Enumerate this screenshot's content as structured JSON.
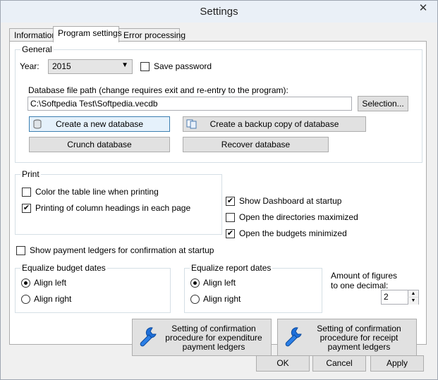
{
  "window": {
    "title": "Settings",
    "close_glyph": "✕"
  },
  "tabs": [
    {
      "label": "Information"
    },
    {
      "label": "Program settings"
    },
    {
      "label": "Error processing"
    }
  ],
  "general": {
    "label": "General",
    "year_label": "Year:",
    "year_value": "2015",
    "save_password_label": "Save password",
    "save_password_checked": false,
    "db_path_label": "Database file path (change requires exit and re-entry to the program):",
    "db_path_value": "C:\\Softpedia Test\\Softpedia.vecdb",
    "selection_button": "Selection...",
    "create_db_button": "Create a new database",
    "backup_button": "Create a backup copy of database",
    "crunch_button": "Crunch database",
    "recover_button": "Recover database"
  },
  "print": {
    "label": "Print",
    "color_line_label": "Color the table line when printing",
    "color_line_checked": false,
    "column_headings_label": "Printing of column headings in each page",
    "column_headings_checked": true
  },
  "options": {
    "show_dashboard_label": "Show Dashboard at startup",
    "show_dashboard_checked": true,
    "dirs_maximized_label": "Open the directories maximized",
    "dirs_maximized_checked": false,
    "budgets_minimized_label": "Open the budgets minimized",
    "budgets_minimized_checked": true,
    "payment_ledgers_label": "Show payment ledgers for confirmation at startup",
    "payment_ledgers_checked": false
  },
  "equalize_budget": {
    "label": "Equalize budget dates",
    "align_left": "Align left",
    "align_right": "Align right",
    "selected": "left"
  },
  "equalize_report": {
    "label": "Equalize report dates",
    "align_left": "Align left",
    "align_right": "Align right",
    "selected": "left"
  },
  "figures": {
    "label_line1": "Amount of figures",
    "label_line2": "to one decimal:",
    "value": "2"
  },
  "confirm_buttons": {
    "expenditure": "Setting of confirmation procedure for expenditure payment ledgers",
    "receipt": "Setting of confirmation procedure for receipt payment ledgers"
  },
  "footer": {
    "ok": "OK",
    "cancel": "Cancel",
    "apply": "Apply"
  },
  "icons": {
    "check": "✔",
    "dropdown": "▼",
    "spin_up": "▲",
    "spin_down": "▼"
  }
}
